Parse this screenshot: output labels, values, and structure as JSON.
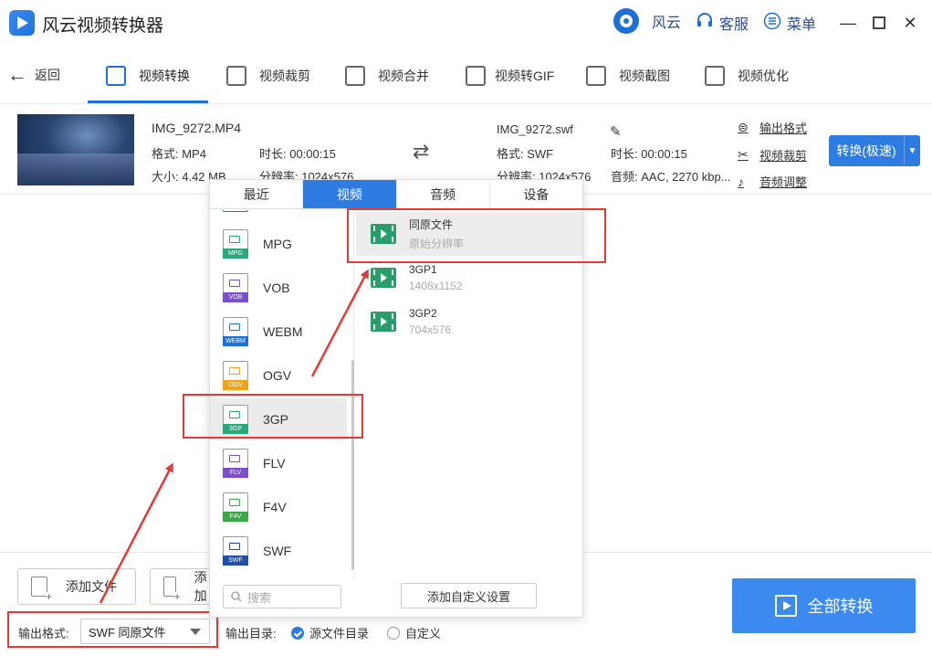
{
  "app": {
    "title": "风云视频转换器",
    "user_label": "风云",
    "service_label": "客服",
    "menu_label": "菜单"
  },
  "nav": {
    "back_label": "返回",
    "tabs": [
      {
        "label": "视频转换",
        "icon": "video-convert-icon"
      },
      {
        "label": "视频裁剪",
        "icon": "video-crop-icon"
      },
      {
        "label": "视频合并",
        "icon": "video-merge-icon"
      },
      {
        "label": "视频转GIF",
        "icon": "gif-icon"
      },
      {
        "label": "视频截图",
        "icon": "screenshot-icon"
      },
      {
        "label": "视频优化",
        "icon": "optimize-icon"
      }
    ]
  },
  "file": {
    "source_name": "IMG_9272.MP4",
    "source_format": "格式: MP4",
    "source_duration": "时长: 00:00:15",
    "source_size": "大小: 4.42 MB",
    "source_resolution": "分辨率: 1024x576",
    "target_name": "IMG_9272.swf",
    "target_format": "格式: SWF",
    "target_duration": "时长: 00:00:15",
    "target_resolution": "分辨率: 1024x576",
    "target_audio": "音频: AAC, 2270 kbp...",
    "links": {
      "output_format": "输出格式",
      "video_crop": "视频裁剪",
      "audio_adjust": "音频调整"
    },
    "convert_label": "转换(极速)"
  },
  "popup": {
    "tabs": [
      "最近",
      "视频",
      "音频",
      "设备"
    ],
    "active_tab": "视频",
    "formats": [
      {
        "name": "MPG",
        "color": "#2aa87a",
        "tag": "MPG"
      },
      {
        "name": "VOB",
        "color": "#7a4fc8",
        "tag": "VOB"
      },
      {
        "name": "WEBM",
        "color": "#1f6fd8",
        "tag": "WEBM"
      },
      {
        "name": "OGV",
        "color": "#f0a21a",
        "tag": "OGV"
      },
      {
        "name": "3GP",
        "color": "#2aa87a",
        "tag": "3GP"
      },
      {
        "name": "FLV",
        "color": "#7a4fc8",
        "tag": "FLV"
      },
      {
        "name": "F4V",
        "color": "#3aa845",
        "tag": "F4V"
      },
      {
        "name": "SWF",
        "color": "#1f4fa8",
        "tag": "SWF"
      }
    ],
    "selected_format": "3GP",
    "resolutions": [
      {
        "name": "同原文件",
        "sub": "原始分辨率"
      },
      {
        "name": "3GP1",
        "sub": "1408x1152"
      },
      {
        "name": "3GP2",
        "sub": "704x576"
      }
    ],
    "search_placeholder": "搜索",
    "custom_button": "添加自定义设置"
  },
  "bottom": {
    "add_file_label": "添加文件",
    "add_folder_label": "添加",
    "output_format_label": "输出格式:",
    "output_format_value": "SWF 同原文件",
    "output_dir_label": "输出目录:",
    "dir_source": "源文件目录",
    "dir_custom": "自定义",
    "convert_all_label": "全部转换"
  }
}
